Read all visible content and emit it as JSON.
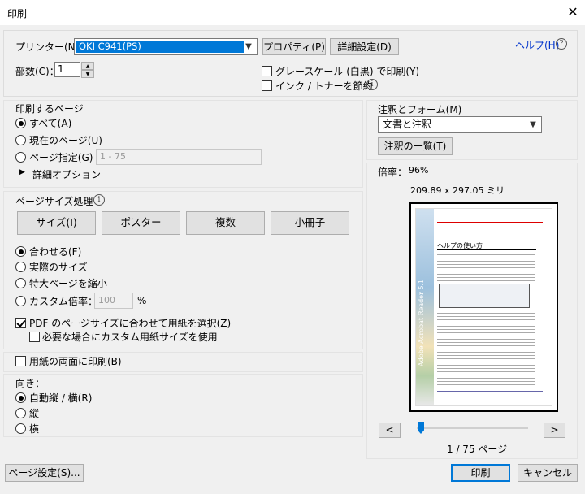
{
  "window": {
    "title": "印刷",
    "close": "✕"
  },
  "printer": {
    "label": "プリンター(N)：",
    "selected": "OKI C941(PS)",
    "properties_label": "プロパティ(P)",
    "advanced_label": "詳細設定(D)",
    "help_label": "ヘルプ(H)",
    "help_icon": "?"
  },
  "copies": {
    "label": "部数(C)：",
    "value": "1"
  },
  "options": {
    "grayscale_label": "グレースケール (白黒) で印刷(Y)",
    "grayscale_checked": false,
    "save_ink_label": "インク / トナーを節約",
    "save_ink_checked": false
  },
  "pages": {
    "section_title": "印刷するページ",
    "all_label": "すべて(A)",
    "current_label": "現在のページ(U)",
    "range_label": "ページ指定(G)",
    "range_value": "1 - 75",
    "more_options_label": "詳細オプション",
    "selected": "all"
  },
  "sizing": {
    "section_title": "ページサイズ処理",
    "buttons": [
      "サイズ(I)",
      "ポスター",
      "複数",
      "小冊子"
    ],
    "fit_label": "合わせる(F)",
    "actual_label": "実際のサイズ",
    "shrink_label": "特大ページを縮小",
    "custom_label": "カスタム倍率：",
    "custom_value": "100",
    "custom_unit": "%",
    "selected": "fit",
    "choose_paper_label": "PDF のページサイズに合わせて用紙を選択(Z)",
    "choose_paper_checked": true,
    "custom_paper_label": "必要な場合にカスタム用紙サイズを使用",
    "custom_paper_checked": false
  },
  "duplex": {
    "label": "用紙の両面に印刷(B)",
    "checked": false
  },
  "orientation": {
    "title": "向き：",
    "auto_label": "自動縦 / 横(R)",
    "portrait_label": "縦",
    "landscape_label": "横",
    "selected": "auto"
  },
  "comments": {
    "title": "注釈とフォーム(M)",
    "selected": "文書と注釈",
    "summary_label": "注釈の一覧(T)"
  },
  "preview": {
    "scale_label": "倍率：",
    "scale_value": "96%",
    "dimensions": "209.89 x 297.05 ミリ",
    "prev_label": "<",
    "next_label": ">",
    "page_indicator": "1 / 75 ページ",
    "doc_heading": "ヘルプの使い方",
    "doc_side_title": "Adobe Acrobat Reader 5.1"
  },
  "footer": {
    "page_setup_label": "ページ設定(S)...",
    "print_label": "印刷",
    "cancel_label": "キャンセル"
  },
  "colors": {
    "accent": "#0078d7",
    "link": "#0033cc",
    "window_bg": "#f0f0f0"
  }
}
